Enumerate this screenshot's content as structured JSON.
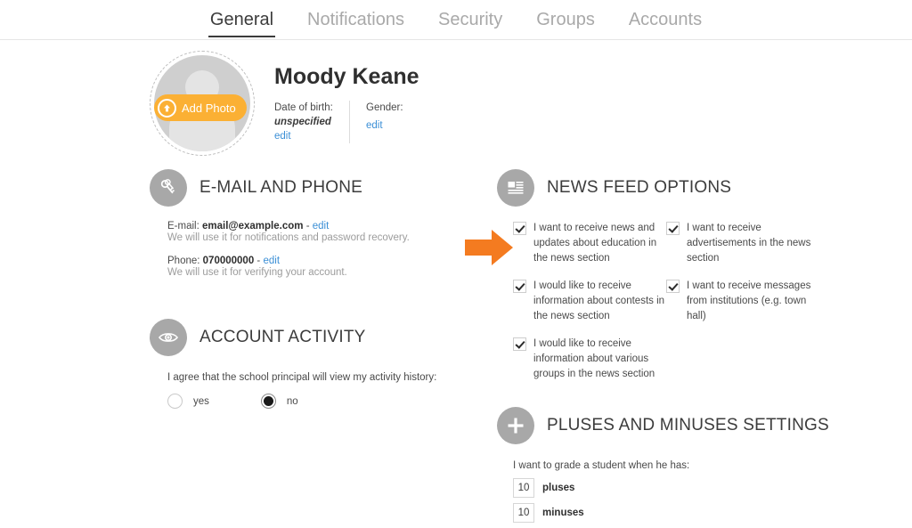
{
  "tabs": [
    {
      "label": "General",
      "active": true
    },
    {
      "label": "Notifications",
      "active": false
    },
    {
      "label": "Security",
      "active": false
    },
    {
      "label": "Groups",
      "active": false
    },
    {
      "label": "Accounts",
      "active": false
    }
  ],
  "profile": {
    "name": "Moody Keane",
    "add_photo_label": "Add Photo",
    "dob_label": "Date of birth:",
    "dob_value": "unspecified",
    "dob_edit": "edit",
    "gender_label": "Gender:",
    "gender_edit": "edit"
  },
  "email_phone": {
    "title": "E-MAIL AND PHONE",
    "email_label": "E-mail:",
    "email_value": "email@example.com",
    "email_sep": "-",
    "email_edit": "edit",
    "email_hint": "We will use it for notifications and password recovery.",
    "phone_label": "Phone:",
    "phone_value": "070000000",
    "phone_sep": "-",
    "phone_edit": "edit",
    "phone_hint": "We will use it for verifying your account."
  },
  "account_activity": {
    "title": "ACCOUNT ACTIVITY",
    "question": "I agree that the school principal will view my activity history:",
    "yes_label": "yes",
    "no_label": "no",
    "selected": "no"
  },
  "news_feed": {
    "title": "NEWS FEED OPTIONS",
    "options": [
      {
        "text": "I want to receive news and updates about education in the news section",
        "checked": true
      },
      {
        "text": "I want to receive advertisements in the news section",
        "checked": true
      },
      {
        "text": "I would like to receive information about contests in the news section",
        "checked": true
      },
      {
        "text": "I want to receive messages from institutions (e.g. town hall)",
        "checked": true
      },
      {
        "text": "I would like to receive information about various groups in the news section",
        "checked": true
      }
    ]
  },
  "pluses_minuses": {
    "title": "PLUSES AND MINUSES SETTINGS",
    "question": "I want to grade a student when he has:",
    "pluses_value": "10",
    "pluses_label": "pluses",
    "minuses_value": "10",
    "minuses_label": "minuses"
  },
  "colors": {
    "accent_orange": "#fbb034",
    "arrow_orange": "#f47b20",
    "link_blue": "#3b8fd6",
    "icon_gray": "#a8a8a8"
  }
}
